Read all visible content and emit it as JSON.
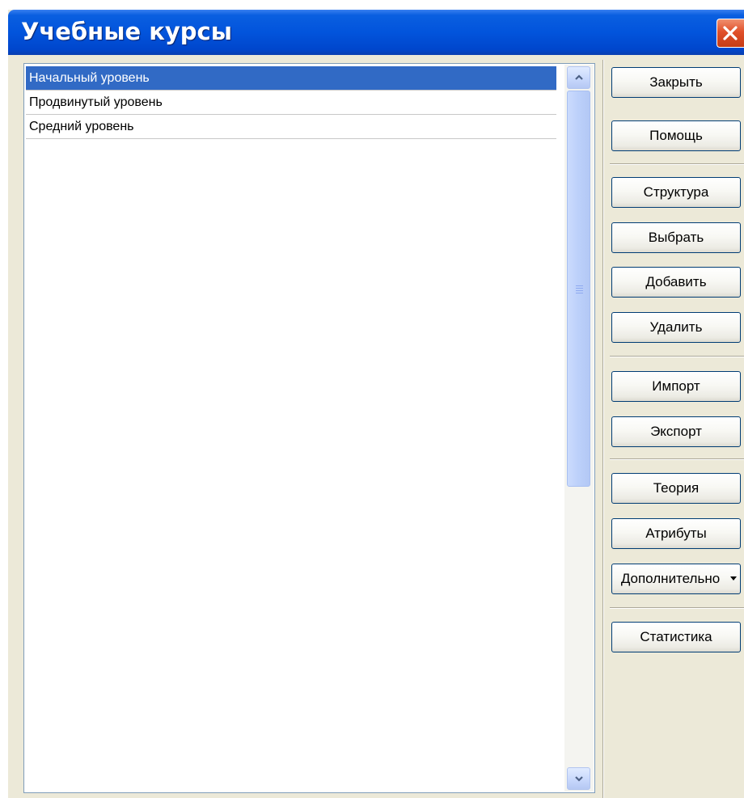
{
  "window": {
    "title": "Учебные курсы"
  },
  "courses": {
    "items": [
      {
        "label": "Начальный уровень",
        "selected": true
      },
      {
        "label": "Продвинутый уровень",
        "selected": false
      },
      {
        "label": "Средний уровень",
        "selected": false
      }
    ]
  },
  "buttons": {
    "close": "Закрыть",
    "help": "Помощь",
    "structure": "Структура",
    "select": "Выбрать",
    "add": "Добавить",
    "delete": "Удалить",
    "import": "Импорт",
    "export": "Экспорт",
    "theory": "Теория",
    "attributes": "Атрибуты",
    "more": "Дополнительно",
    "statistics": "Статистика"
  },
  "colors": {
    "titlebar": "#0254dc",
    "selection": "#316ac5",
    "close_button": "#e0502a",
    "dialog_background": "#ece9d8"
  },
  "icons": {
    "close": "close-x-icon",
    "scroll_up": "chevron-up-icon",
    "scroll_down": "chevron-down-icon",
    "dropdown": "caret-down-icon"
  }
}
